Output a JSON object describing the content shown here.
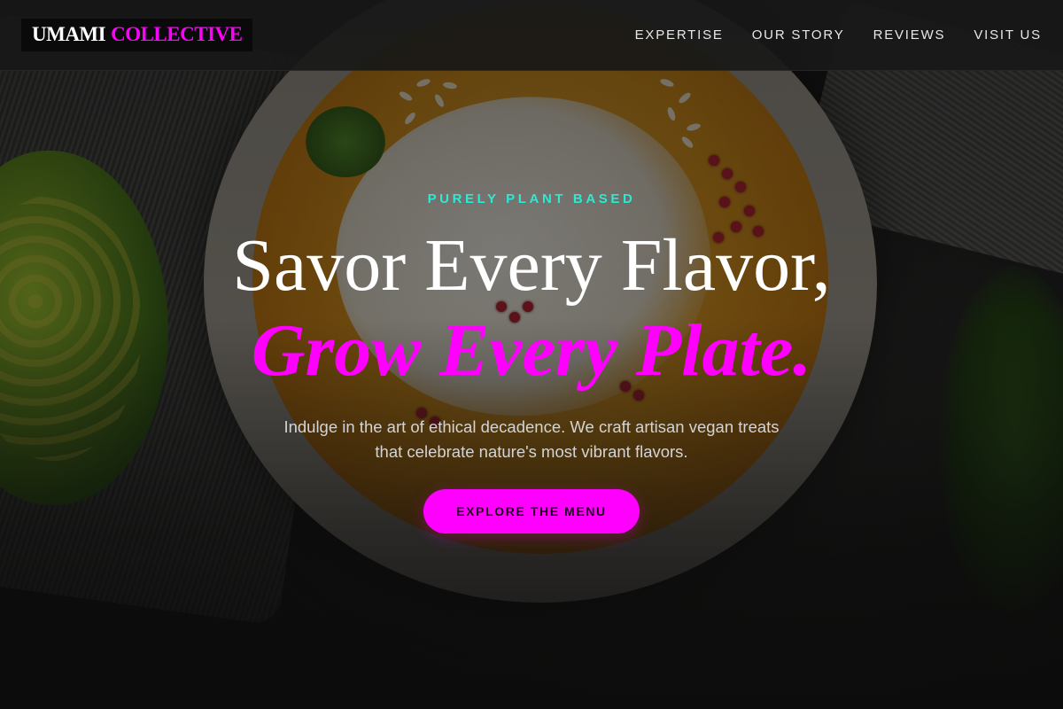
{
  "brand": {
    "name_part1": "UMAMI",
    "name_part2": "COLLECTIVE",
    "accent_color": "#ff00ff"
  },
  "nav": {
    "items": [
      {
        "label": "EXPERTISE"
      },
      {
        "label": "OUR STORY"
      },
      {
        "label": "REVIEWS"
      },
      {
        "label": "VISIT US"
      }
    ]
  },
  "hero": {
    "eyebrow": "PURELY PLANT BASED",
    "eyebrow_color": "#2ee8d4",
    "headline_line1": "Savor Every Flavor,",
    "headline_line2": "Grow Every Plate.",
    "subtitle_line1": "Indulge in the art of ethical decadence. We craft artisan vegan treats",
    "subtitle_line2": "that celebrate nature's most vibrant flavors.",
    "cta_label": "EXPLORE THE MENU",
    "background_image": "bowl of squash soup with cream, pomegranate seeds and pumpkin seeds"
  }
}
